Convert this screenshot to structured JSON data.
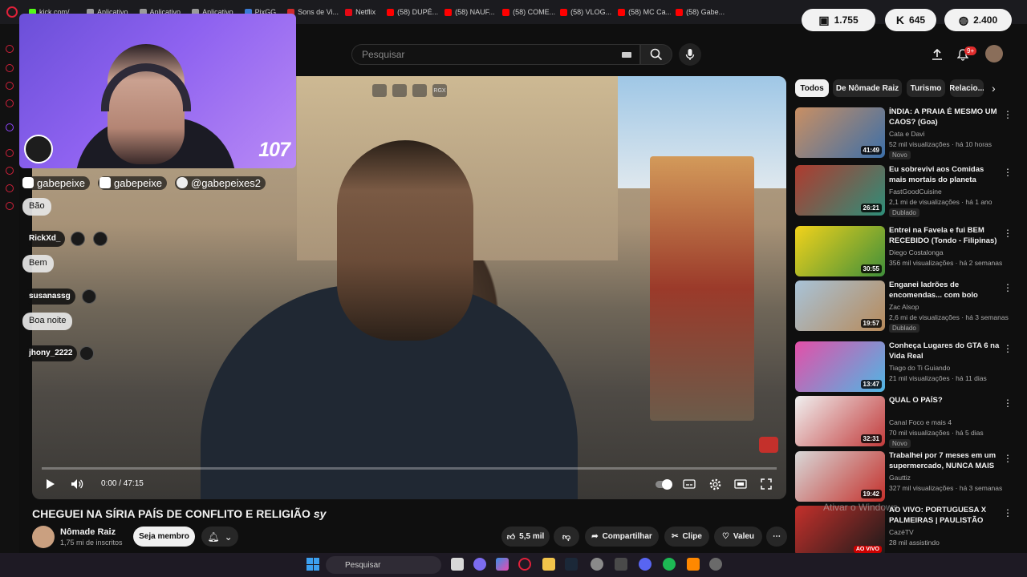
{
  "browser": {
    "bookmarks": [
      {
        "label": "kick.com/...",
        "color": "#53fc18"
      },
      {
        "label": "Aplicativo",
        "color": "#9b9b9b"
      },
      {
        "label": "Aplicativo",
        "color": "#9b9b9b"
      },
      {
        "label": "Aplicativo",
        "color": "#9b9b9b"
      },
      {
        "label": "PixGG",
        "color": "#3a7bd5"
      },
      {
        "label": "Sons de Vi...",
        "color": "#d02b2b"
      },
      {
        "label": "Netflix",
        "color": "#e50914"
      },
      {
        "label": "(58) DUPÉ...",
        "color": "#ff0000"
      },
      {
        "label": "(58) NAUF...",
        "color": "#ff0000"
      },
      {
        "label": "(58) COME...",
        "color": "#ff0000"
      },
      {
        "label": "(58) VLOG...",
        "color": "#ff0000"
      },
      {
        "label": "(58) MC Ca...",
        "color": "#ff0000"
      },
      {
        "label": "(58) Gabe...",
        "color": "#ff0000"
      }
    ]
  },
  "counters": [
    {
      "icon": "chat-bubble-icon",
      "value": "1.755"
    },
    {
      "icon": "kick-icon",
      "value": "645"
    },
    {
      "icon": "globe-icon",
      "value": "2.400"
    }
  ],
  "search": {
    "placeholder": "Pesquisar"
  },
  "header": {
    "notifications": "9+"
  },
  "overlay": {
    "viewer_number": "107",
    "socials": [
      {
        "icon": "youtube-icon",
        "handle": "gabepeixe"
      },
      {
        "icon": "instagram-icon",
        "handle": "gabepeixe"
      },
      {
        "icon": "tiktok-icon",
        "handle": "@gabepeixes2"
      }
    ],
    "chat": [
      {
        "type": "message",
        "text": "Bão"
      },
      {
        "type": "user",
        "text": "RickXd_"
      },
      {
        "type": "message",
        "text": "Bem"
      },
      {
        "type": "user",
        "text": "susanassg"
      },
      {
        "type": "message",
        "text": "Boa noite"
      },
      {
        "type": "user",
        "text": "jhony_2222"
      }
    ]
  },
  "player": {
    "time": "0:00 / 47:15",
    "progress": 0,
    "top_icons": [
      "",
      "",
      "",
      "RGX"
    ]
  },
  "video": {
    "title": "CHEGUEI NA SÍRIA PAÍS DE CONFLITO E RELIGIÃO",
    "title_suffix": "sy",
    "channel": "Nômade Raiz",
    "subscribers": "1,75 mi de inscritos",
    "join_label": "Seja membro",
    "likes": "5,5 mil",
    "share_label": "Compartilhar",
    "clip_label": "Clipe",
    "thanks_label": "Valeu"
  },
  "chips": [
    "Todos",
    "De Nômade Raiz",
    "Turismo",
    "Relacio..."
  ],
  "recommendations": [
    {
      "title": "ÍNDIA: A PRAIA É MESMO UM CAOS? (Goa)",
      "channel": "Cata e Davi",
      "meta": "52 mil visualizações · há 10 horas",
      "badge": "Novo",
      "duration": "41:49",
      "c1": "#c98f63",
      "c2": "#3c6fa8"
    },
    {
      "title": "Eu sobrevivi aos Comidas mais mortais do planeta",
      "channel": "FastGoodCuisine",
      "meta": "2,1 mi de visualizações · há 1 ano",
      "badge": "Dublado",
      "duration": "26:21",
      "c1": "#b03a2e",
      "c2": "#2d8f7a"
    },
    {
      "title": "Entrei na Favela e fui BEM RECEBIDO (Tondo - Filipinas)",
      "channel": "Diego Costalonga",
      "meta": "356 mil visualizações · há 2 semanas",
      "badge": "",
      "duration": "30:55",
      "c1": "#f2d21b",
      "c2": "#3f8f3a"
    },
    {
      "title": "Enganei ladrões de encomendas... com bolo",
      "channel": "Zac Alsop",
      "meta": "2,6 mi de visualizações · há 3 semanas",
      "badge": "Dublado",
      "duration": "19:57",
      "c1": "#a8c3d8",
      "c2": "#b78a5a"
    },
    {
      "title": "Conheça Lugares do GTA 6 na Vida Real",
      "channel": "Tiago do Ti Guiando",
      "meta": "21 mil visualizações · há 11 dias",
      "badge": "",
      "duration": "13:47",
      "c1": "#e44fa8",
      "c2": "#4fb6e4"
    },
    {
      "title": "QUAL O PAÍS?",
      "channel": "Canal Foco e mais 4",
      "meta": "70 mil visualizações · há 5 dias",
      "badge": "Novo",
      "duration": "32:31",
      "c1": "#f0f0f0",
      "c2": "#c23a3a"
    },
    {
      "title": "Trabalhei por 7 meses em um supermercado, NUNCA MAIS ...",
      "channel": "Gauttiz",
      "meta": "327 mil visualizações · há 3 semanas",
      "badge": "",
      "duration": "19:42",
      "c1": "#d8d8d8",
      "c2": "#c4302b"
    },
    {
      "title": "AO VIVO: PORTUGUESA X PALMEIRAS | PAULISTÃO 202...",
      "channel": "CazéTV",
      "meta": "28 mil assistindo",
      "badge": "",
      "duration": "AO VIVO",
      "live": true,
      "c1": "#c4302b",
      "c2": "#1a1a1a"
    }
  ],
  "watermark": "Ativar o Windows",
  "taskbar": {
    "search_placeholder": "Pesquisar"
  }
}
